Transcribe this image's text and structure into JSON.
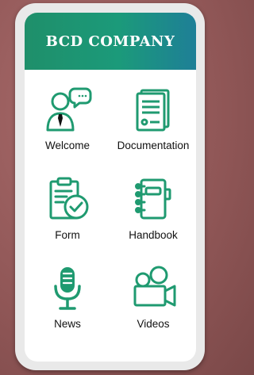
{
  "app": {
    "title": "BCD COMPANY"
  },
  "colors": {
    "accent": "#1f9a70",
    "header_end": "#1e7f97"
  },
  "menu": [
    {
      "label": "Welcome",
      "icon": "welcome-speech-icon"
    },
    {
      "label": "Documentation",
      "icon": "document-icon"
    },
    {
      "label": "Form",
      "icon": "clipboard-check-icon"
    },
    {
      "label": "Handbook",
      "icon": "notebook-icon"
    },
    {
      "label": "News",
      "icon": "microphone-icon"
    },
    {
      "label": "Videos",
      "icon": "video-camera-icon"
    }
  ]
}
